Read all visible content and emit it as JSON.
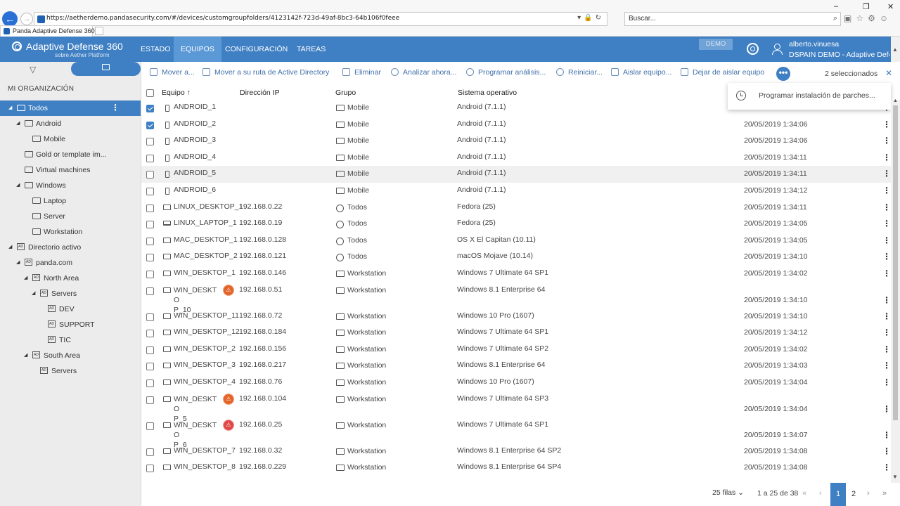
{
  "browser": {
    "url": "https://aetherdemo.pandasecurity.com/#/devices/customgroupfolders/4123142f-723d-49af-8bc3-64b106f0feee",
    "search_placeholder": "Buscar...",
    "tab_title": "Panda Adaptive Defense 360",
    "window_controls": [
      "–",
      "❐",
      "✕"
    ]
  },
  "app": {
    "brand": "Adaptive Defense 360",
    "brand_sub": "sobre Aether Platform",
    "menu": [
      "ESTADO",
      "EQUIPOS",
      "CONFIGURACIÓN",
      "TAREAS"
    ],
    "active_menu": "EQUIPOS",
    "demo_label": "DEMO",
    "user_name": "alberto.vinuesa",
    "user_org": "DSPAIN DEMO - Adaptive Defer"
  },
  "sidebar": {
    "title": "MI ORGANIZACIÓN",
    "tree": [
      {
        "label": "Todos",
        "level": 0,
        "arrow": "◢",
        "icon": "all-folder",
        "selected": true
      },
      {
        "label": "Android",
        "level": 1,
        "arrow": "◢",
        "icon": "folder"
      },
      {
        "label": "Mobile",
        "level": 2,
        "arrow": "",
        "icon": "folder"
      },
      {
        "label": "Gold or template im...",
        "level": 1,
        "arrow": "",
        "icon": "folder"
      },
      {
        "label": "Virtual machines",
        "level": 1,
        "arrow": "",
        "icon": "folder"
      },
      {
        "label": "Windows",
        "level": 1,
        "arrow": "◢",
        "icon": "folder"
      },
      {
        "label": "Laptop",
        "level": 2,
        "arrow": "",
        "icon": "folder"
      },
      {
        "label": "Server",
        "level": 2,
        "arrow": "",
        "icon": "folder"
      },
      {
        "label": "Workstation",
        "level": 2,
        "arrow": "",
        "icon": "folder"
      },
      {
        "label": "Directorio activo",
        "level": 0,
        "arrow": "◢",
        "icon": "ad-folder"
      },
      {
        "label": "panda.com",
        "level": 1,
        "arrow": "◢",
        "icon": "ad-folder"
      },
      {
        "label": "North Area",
        "level": 2,
        "arrow": "◢",
        "icon": "ad-folder"
      },
      {
        "label": "Servers",
        "level": 3,
        "arrow": "◢",
        "icon": "ad-folder"
      },
      {
        "label": "DEV",
        "level": 4,
        "arrow": "",
        "icon": "ad-folder"
      },
      {
        "label": "SUPPORT",
        "level": 4,
        "arrow": "",
        "icon": "ad-folder"
      },
      {
        "label": "TIC",
        "level": 4,
        "arrow": "",
        "icon": "ad-folder"
      },
      {
        "label": "South Area",
        "level": 2,
        "arrow": "◢",
        "icon": "ad-folder"
      },
      {
        "label": "Servers",
        "level": 3,
        "arrow": "",
        "icon": "ad-folder"
      }
    ]
  },
  "toolbar": {
    "actions": [
      {
        "label": "Mover a...",
        "icon": "move-icon"
      },
      {
        "label": "Mover a su ruta de Active Directory",
        "icon": "ad-move-icon"
      },
      {
        "label": "Eliminar",
        "icon": "trash-icon"
      },
      {
        "label": "Analizar ahora...",
        "icon": "scan-icon"
      },
      {
        "label": "Programar análisis...",
        "icon": "schedule-icon"
      },
      {
        "label": "Reiniciar...",
        "icon": "restart-icon"
      },
      {
        "label": "Aislar equipo...",
        "icon": "isolate-icon"
      },
      {
        "label": "Dejar de aislar equipo",
        "icon": "unisolate-icon"
      }
    ],
    "more_label": "•••",
    "selected_count": "2 seleccionados",
    "close_label": "✕"
  },
  "popup": {
    "item": "Programar instalación de parches..."
  },
  "table": {
    "columns": {
      "equipo": "Equipo ↑",
      "ip": "Dirección IP",
      "grupo": "Grupo",
      "so": "Sistema operativo"
    },
    "rows": [
      {
        "name": "ANDROID_1",
        "device": "phone",
        "ip": "",
        "group": "Mobile",
        "group_icon": "folder",
        "os": "Android (7.1.1)",
        "date": "",
        "checked": true
      },
      {
        "name": "ANDROID_2",
        "device": "phone",
        "ip": "",
        "group": "Mobile",
        "group_icon": "folder",
        "os": "Android (7.1.1)",
        "date": "20/05/2019 1:34:06",
        "checked": true
      },
      {
        "name": "ANDROID_3",
        "device": "phone",
        "ip": "",
        "group": "Mobile",
        "group_icon": "folder",
        "os": "Android (7.1.1)",
        "date": "20/05/2019 1:34:06",
        "checked": false
      },
      {
        "name": "ANDROID_4",
        "device": "phone",
        "ip": "",
        "group": "Mobile",
        "group_icon": "folder",
        "os": "Android (7.1.1)",
        "date": "20/05/2019 1:34:11",
        "checked": false
      },
      {
        "name": "ANDROID_5",
        "device": "phone",
        "ip": "",
        "group": "Mobile",
        "group_icon": "folder",
        "os": "Android (7.1.1)",
        "date": "20/05/2019 1:34:11",
        "checked": false,
        "highlight": true
      },
      {
        "name": "ANDROID_6",
        "device": "phone",
        "ip": "",
        "group": "Mobile",
        "group_icon": "folder",
        "os": "Android (7.1.1)",
        "date": "20/05/2019 1:34:12",
        "checked": false
      },
      {
        "name": "LINUX_DESKTOP_1",
        "device": "desktop",
        "ip": "192.168.0.22",
        "group": "Todos",
        "group_icon": "all",
        "os": "Fedora (25)",
        "date": "20/05/2019 1:34:11",
        "checked": false
      },
      {
        "name": "LINUX_LAPTOP_1",
        "device": "laptop",
        "ip": "192.168.0.19",
        "group": "Todos",
        "group_icon": "all",
        "os": "Fedora (25)",
        "date": "20/05/2019 1:34:05",
        "checked": false
      },
      {
        "name": "MAC_DESKTOP_1",
        "device": "desktop",
        "ip": "192.168.0.128",
        "group": "Todos",
        "group_icon": "all",
        "os": "OS X El Capitan (10.11)",
        "date": "20/05/2019 1:34:05",
        "checked": false
      },
      {
        "name": "MAC_DESKTOP_2",
        "device": "desktop",
        "ip": "192.168.0.121",
        "group": "Todos",
        "group_icon": "all",
        "os": "macOS Mojave (10.14)",
        "date": "20/05/2019 1:34:10",
        "checked": false
      },
      {
        "name": "WIN_DESKTOP_1",
        "device": "desktop",
        "ip": "192.168.0.146",
        "group": "Workstation",
        "group_icon": "folder",
        "os": "Windows 7 Ultimate 64 SP1",
        "date": "20/05/2019 1:34:02",
        "checked": false
      },
      {
        "name": "WIN_DESKTOP_10",
        "device": "desktop",
        "ip": "192.168.0.51",
        "group": "Workstation",
        "group_icon": "folder",
        "os": "Windows 8.1 Enterprise 64",
        "date": "20/05/2019 1:34:10",
        "checked": false,
        "wrap": [
          "WIN_DESKTO",
          "P_10"
        ],
        "badge": "orange"
      },
      {
        "name": "WIN_DESKTOP_11",
        "device": "desktop",
        "ip": "192.168.0.72",
        "group": "Workstation",
        "group_icon": "folder",
        "os": "Windows 10 Pro (1607)",
        "date": "20/05/2019 1:34:10",
        "checked": false
      },
      {
        "name": "WIN_DESKTOP_12",
        "device": "desktop",
        "ip": "192.168.0.184",
        "group": "Workstation",
        "group_icon": "folder",
        "os": "Windows 7 Ultimate 64 SP1",
        "date": "20/05/2019 1:34:12",
        "checked": false
      },
      {
        "name": "WIN_DESKTOP_2",
        "device": "desktop",
        "ip": "192.168.0.156",
        "group": "Workstation",
        "group_icon": "folder",
        "os": "Windows 7 Ultimate 64 SP2",
        "date": "20/05/2019 1:34:02",
        "checked": false
      },
      {
        "name": "WIN_DESKTOP_3",
        "device": "desktop",
        "ip": "192.168.0.217",
        "group": "Workstation",
        "group_icon": "folder",
        "os": "Windows 8.1 Enterprise 64",
        "date": "20/05/2019 1:34:03",
        "checked": false
      },
      {
        "name": "WIN_DESKTOP_4",
        "device": "desktop",
        "ip": "192.168.0.76",
        "group": "Workstation",
        "group_icon": "folder",
        "os": "Windows 10 Pro (1607)",
        "date": "20/05/2019 1:34:04",
        "checked": false
      },
      {
        "name": "WIN_DESKTOP_5",
        "device": "desktop",
        "ip": "192.168.0.104",
        "group": "Workstation",
        "group_icon": "folder",
        "os": "Windows 7 Ultimate 64 SP3",
        "date": "20/05/2019 1:34:04",
        "checked": false,
        "wrap": [
          "WIN_DESKTO",
          "P_5"
        ],
        "badge": "orange"
      },
      {
        "name": "WIN_DESKTOP_6",
        "device": "desktop",
        "ip": "192.168.0.25",
        "group": "Workstation",
        "group_icon": "folder",
        "os": "Windows 7 Ultimate 64 SP1",
        "date": "20/05/2019 1:34:07",
        "checked": false,
        "wrap": [
          "WIN_DESKTO",
          "P_6"
        ],
        "badge": "red"
      },
      {
        "name": "WIN_DESKTOP_7",
        "device": "desktop",
        "ip": "192.168.0.32",
        "group": "Workstation",
        "group_icon": "folder",
        "os": "Windows 8.1 Enterprise 64 SP2",
        "date": "20/05/2019 1:34:08",
        "checked": false
      },
      {
        "name": "WIN_DESKTOP_8",
        "device": "desktop",
        "ip": "192.168.0.229",
        "group": "Workstation",
        "group_icon": "folder",
        "os": "Windows 8.1 Enterprise 64 SP4",
        "date": "20/05/2019 1:34:08",
        "checked": false
      }
    ]
  },
  "pager": {
    "rows_per_page": "25 filas",
    "range": "1 a 25 de 38",
    "pages": [
      "1",
      "2"
    ],
    "current_page": "1",
    "first": "«",
    "prev": "‹",
    "next": "›",
    "last": "»"
  },
  "colors": {
    "accent": "#3f7fc3",
    "header": "#3f7fc3",
    "active_menu": "#5b98d6",
    "badge_orange": "#e3642a",
    "badge_red": "#e04848"
  }
}
